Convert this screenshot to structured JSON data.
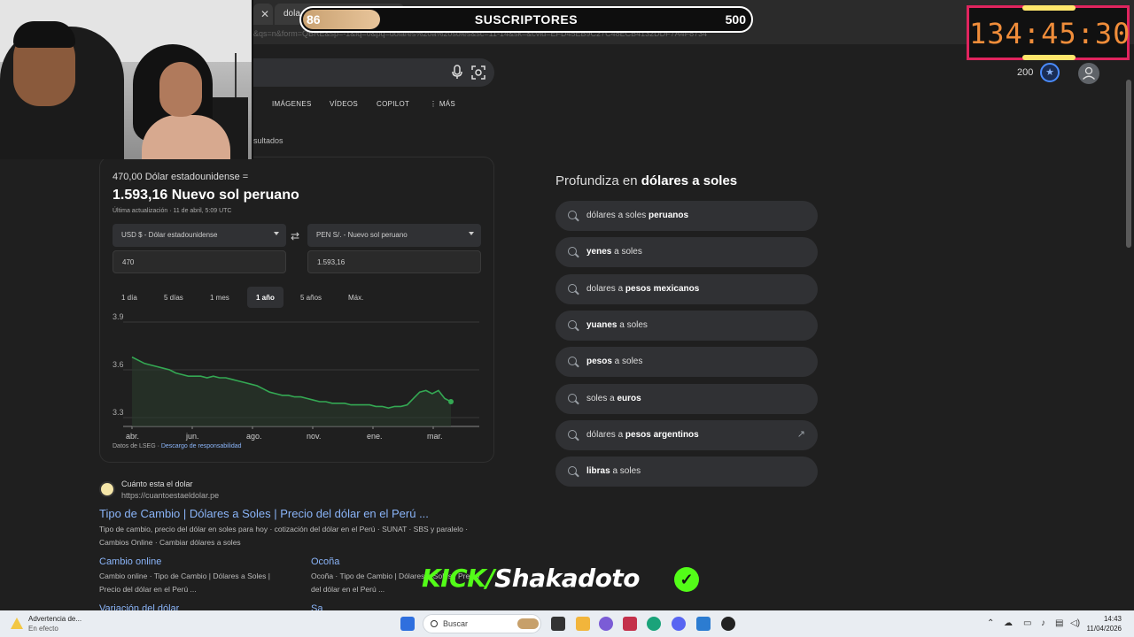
{
  "browser": {
    "tab_active_label": "dola",
    "address_fragment": "&qs=n&form=QBRE&sp=-1&lq=0&pq=dolares%20a%20soles&sc=11-14&sk=&cvid=EFD45EB9C27C48ECB4132DDF7A4F8734"
  },
  "overlay": {
    "sub_current": "86",
    "sub_label": "SUSCRIPTORES",
    "sub_goal": "500",
    "sub_progress": 0.172,
    "timer": "134:45:30",
    "kick_prefix": "KICK/",
    "kick_name": "Shakadoto"
  },
  "header": {
    "rewards_points": "200",
    "nav_tabs": [
      "IMÁGENES",
      "VÍDEOS",
      "COPILOT",
      "⋮ MÁS"
    ],
    "results_count": "sultados"
  },
  "converter": {
    "from_text": "470,00 Dólar estadounidense =",
    "result_text": "1.593,16 Nuevo sol peruano",
    "updated": "Última actualización · 11 de abril, 5:09 UTC",
    "from_currency": "USD $ - Dólar estadounidense",
    "to_currency": "PEN S/. - Nuevo sol peruano",
    "from_amount": "470",
    "to_amount": "1.593,16",
    "ranges": [
      "1 día",
      "5 días",
      "1 mes",
      "1 año",
      "5 años",
      "Máx."
    ],
    "active_range": "1 año",
    "source": "Datos de LSEG · ",
    "disclaimer": "Descargo de responsabilidad"
  },
  "chart_data": {
    "type": "line",
    "title": "",
    "xlabel": "",
    "ylabel": "",
    "ylim": [
      3.3,
      3.9
    ],
    "yticks": [
      "3.9",
      "3.6",
      "3.3"
    ],
    "xticks": [
      "abr.",
      "jun.",
      "ago.",
      "nov.",
      "ene.",
      "mar."
    ],
    "grid": true,
    "series": [
      {
        "values": [
          3.68,
          3.66,
          3.64,
          3.63,
          3.62,
          3.61,
          3.6,
          3.58,
          3.57,
          3.56,
          3.56,
          3.56,
          3.55,
          3.56,
          3.55,
          3.55,
          3.54,
          3.53,
          3.52,
          3.51,
          3.5,
          3.48,
          3.46,
          3.45,
          3.44,
          3.44,
          3.43,
          3.43,
          3.42,
          3.41,
          3.4,
          3.4,
          3.39,
          3.39,
          3.39,
          3.38,
          3.38,
          3.38,
          3.38,
          3.37,
          3.37,
          3.36,
          3.37,
          3.37,
          3.38,
          3.42,
          3.46,
          3.47,
          3.45,
          3.47,
          3.42,
          3.4
        ]
      }
    ]
  },
  "result": {
    "site_name": "Cuánto esta el dolar",
    "site_url": "https://cuantoestaeldolar.pe",
    "title": "Tipo de Cambio | Dólares a Soles | Precio del dólar en el Perú ...",
    "snippet": "Tipo de cambio, precio del dólar en soles para hoy · cotización del dólar en el Perú · SUNAT · SBS y paralelo · Cambios Online · Cambiar dólares a soles",
    "sub1_title": "Cambio online",
    "sub1_snippet": "Cambio online · Tipo de Cambio | Dólares a Soles | Precio del dólar en el Perú ...",
    "sub2_title": "Ocoña",
    "sub2_snippet": "Ocoña · Tipo de Cambio | Dólares a Soles | Precio del dólar en el Perú ...",
    "sub3_title": "Variación del dólar",
    "sub4_title": "Sa"
  },
  "related": {
    "heading_prefix": "Profundiza en ",
    "heading_bold": "dólares a soles",
    "items": [
      {
        "pre": "dólares a soles ",
        "bold": "peruanos",
        "post": ""
      },
      {
        "pre": "",
        "bold": "yenes",
        "post": " a soles"
      },
      {
        "pre": "dolares a ",
        "bold": "pesos mexicanos",
        "post": ""
      },
      {
        "pre": "",
        "bold": "yuanes",
        "post": " a soles"
      },
      {
        "pre": "",
        "bold": "pesos",
        "post": " a soles"
      },
      {
        "pre": "soles a ",
        "bold": "euros",
        "post": ""
      },
      {
        "pre": "dólares a ",
        "bold": "pesos argentinos",
        "post": ""
      },
      {
        "pre": "",
        "bold": "libras",
        "post": " a soles"
      }
    ]
  },
  "taskbar": {
    "warning_title": "Advertencia de...",
    "warning_sub": "En efecto",
    "search_placeholder": "Buscar",
    "time": "14:43",
    "date": "11/04/2026"
  }
}
